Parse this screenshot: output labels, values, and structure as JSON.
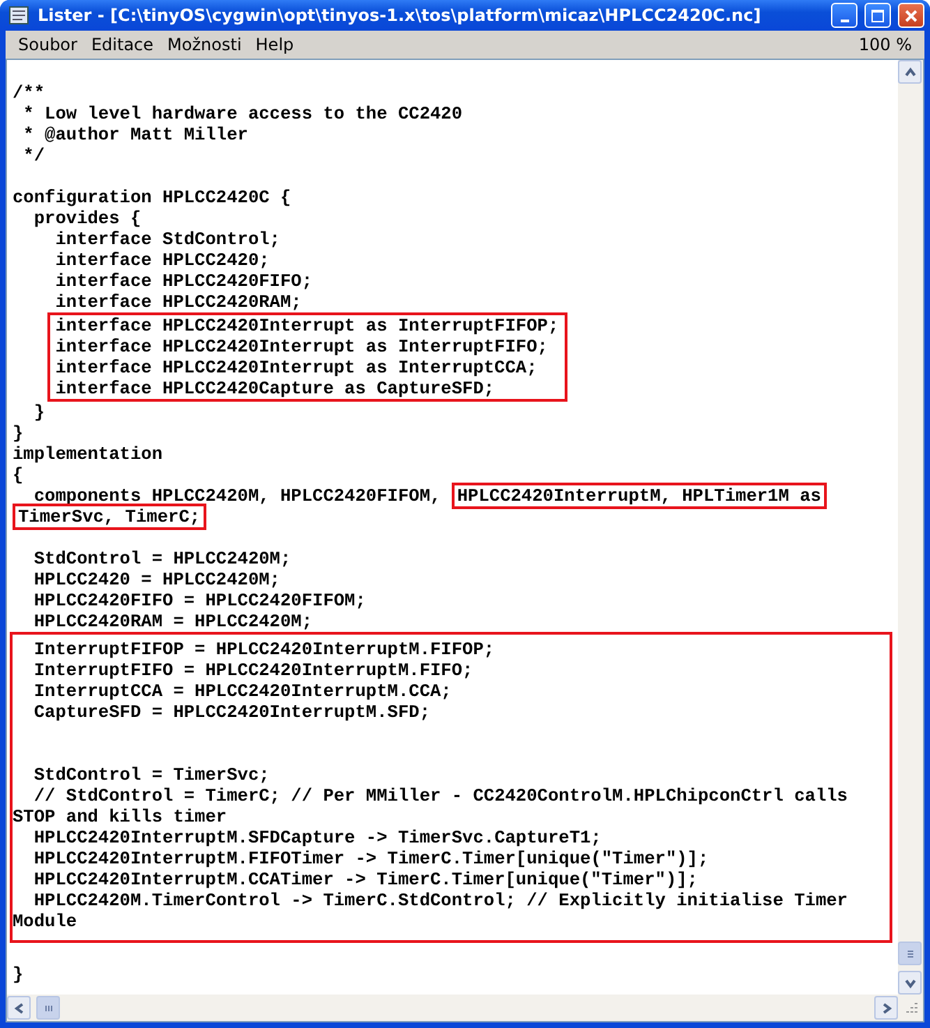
{
  "window": {
    "title": "Lister - [C:\\tinyOS\\cygwin\\opt\\tinyos-1.x\\tos\\platform\\micaz\\HPLCC2420C.nc]"
  },
  "menu": [
    "Soubor",
    "Editace",
    "Možnosti",
    "Help"
  ],
  "zoom": "100 %",
  "code": [
    {
      "kind": "gap"
    },
    {
      "kind": "plain",
      "lines": [
        "/**",
        " * Low level hardware access to the CC2420",
        " * @author Matt Miller",
        " */"
      ]
    },
    {
      "kind": "gap"
    },
    {
      "kind": "plain",
      "lines": [
        "configuration HPLCC2420C {",
        "  provides {",
        "    interface StdControl;",
        "    interface HPLCC2420;",
        "    interface HPLCC2420FIFO;",
        "    interface HPLCC2420RAM;"
      ]
    },
    {
      "kind": "boxed",
      "lines": [
        "    interface HPLCC2420Interrupt as InterruptFIFOP;",
        "    interface HPLCC2420Interrupt as InterruptFIFO;",
        "    interface HPLCC2420Interrupt as InterruptCCA;",
        "    interface HPLCC2420Capture as CaptureSFD;"
      ]
    },
    {
      "kind": "plain",
      "lines": [
        "  }",
        "}",
        "implementation",
        "{"
      ]
    },
    {
      "kind": "marked",
      "lines": [
        [
          {
            "text": "  components HPLCC2420M, HPLCC2420FIFOM, ",
            "marked": false
          },
          {
            "text": "HPLCC2420InterruptM, HPLTimer1M as",
            "marked": true
          }
        ],
        [
          {
            "text": "TimerSvc, TimerC;",
            "marked": true
          }
        ]
      ]
    },
    {
      "kind": "gap"
    },
    {
      "kind": "plain",
      "lines": [
        "  StdControl = HPLCC2420M;",
        "  HPLCC2420 = HPLCC2420M;",
        "  HPLCC2420FIFO = HPLCC2420FIFOM;",
        "  HPLCC2420RAM = HPLCC2420M;"
      ]
    },
    {
      "kind": "boxed_full",
      "lines": [
        {
          "kind": "code",
          "text": "  InterruptFIFOP = HPLCC2420InterruptM.FIFOP;"
        },
        {
          "kind": "code",
          "text": "  InterruptFIFO = HPLCC2420InterruptM.FIFO;"
        },
        {
          "kind": "code",
          "text": "  InterruptCCA = HPLCC2420InterruptM.CCA;"
        },
        {
          "kind": "code",
          "text": "  CaptureSFD = HPLCC2420InterruptM.SFD;"
        },
        {
          "kind": "blank"
        },
        {
          "kind": "blank"
        },
        {
          "kind": "code",
          "text": "  StdControl = TimerSvc;"
        },
        {
          "kind": "code",
          "text": "  // StdControl = TimerC; // Per MMiller - CC2420ControlM.HPLChipconCtrl calls"
        },
        {
          "kind": "code",
          "text": "STOP and kills timer"
        },
        {
          "kind": "code",
          "text": "  HPLCC2420InterruptM.SFDCapture -> TimerSvc.CaptureT1;"
        },
        {
          "kind": "code",
          "text": "  HPLCC2420InterruptM.FIFOTimer -> TimerC.Timer[unique(\"Timer\")];"
        },
        {
          "kind": "code",
          "text": "  HPLCC2420InterruptM.CCATimer -> TimerC.Timer[unique(\"Timer\")];"
        },
        {
          "kind": "code",
          "text": "  HPLCC2420M.TimerControl -> TimerC.StdControl; // Explicitly initialise Timer"
        },
        {
          "kind": "code",
          "text": "Module"
        }
      ]
    },
    {
      "kind": "gap"
    },
    {
      "kind": "plain",
      "lines": [
        "}"
      ]
    }
  ]
}
